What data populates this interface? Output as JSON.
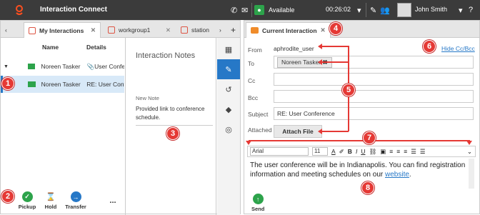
{
  "app": {
    "title": "Interaction Connect"
  },
  "topbar": {
    "status": "Available",
    "timer": "00:26:02",
    "user": "John Smith"
  },
  "tabs": [
    {
      "label": "My Interactions"
    },
    {
      "label": "workgroup1"
    },
    {
      "label": "station"
    }
  ],
  "grid": {
    "columns": [
      "Name",
      "Details"
    ],
    "rows": [
      {
        "name": "Noreen Tasker",
        "details": "User Confe"
      },
      {
        "name": "Noreen Tasker",
        "details": "RE: User Conf"
      }
    ]
  },
  "notes": {
    "title": "Interaction Notes",
    "new_note_label": "New Note",
    "text": "Provided link to conference schedule."
  },
  "actions": {
    "pickup": "Pickup",
    "hold": "Hold",
    "transfer": "Transfer",
    "more": "..."
  },
  "email": {
    "tab": "Current Interaction",
    "from_label": "From",
    "from": "aphrodite_user",
    "to_label": "To",
    "to_chip": "Noreen Tasker",
    "cc_label": "Cc",
    "bcc_label": "Bcc",
    "subject_label": "Subject",
    "subject": "RE: User Conference",
    "attached_label": "Attached",
    "attach_button": "Attach File",
    "hide_ccbcc": "Hide Cc/Bcc",
    "font": "Arial",
    "size": "11",
    "body_text": "The user conference will be in Indianapolis. You can find registration information and meeting schedules on our ",
    "body_link": "website",
    "send": "Send"
  },
  "badges": [
    "1",
    "2",
    "3",
    "4",
    "5",
    "6",
    "7",
    "8"
  ],
  "colors": {
    "accent": "#2678c7",
    "green": "#2da34b",
    "callout": "#e53935",
    "topbar": "#3b3b3b"
  }
}
